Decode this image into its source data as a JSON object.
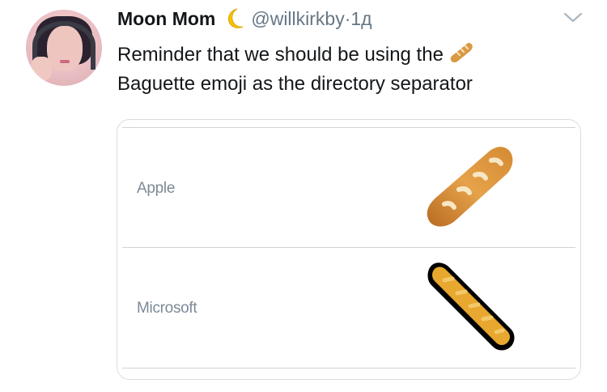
{
  "tweet": {
    "author_name": "Moon Mom",
    "author_handle": "@willkirkby",
    "separator": " · ",
    "timestamp": "1д",
    "text_part1": "Reminder that we should be using the ",
    "text_part2": "Baguette emoji as the directory separator"
  },
  "card": {
    "rows": [
      {
        "label": "Apple",
        "emoji": "baguette-apple-icon"
      },
      {
        "label": "Microsoft",
        "emoji": "baguette-microsoft-icon"
      }
    ]
  },
  "colors": {
    "name": "#14171a",
    "handle": "#657786",
    "card_border": "#d9dde2",
    "label": "#7b8a99"
  }
}
